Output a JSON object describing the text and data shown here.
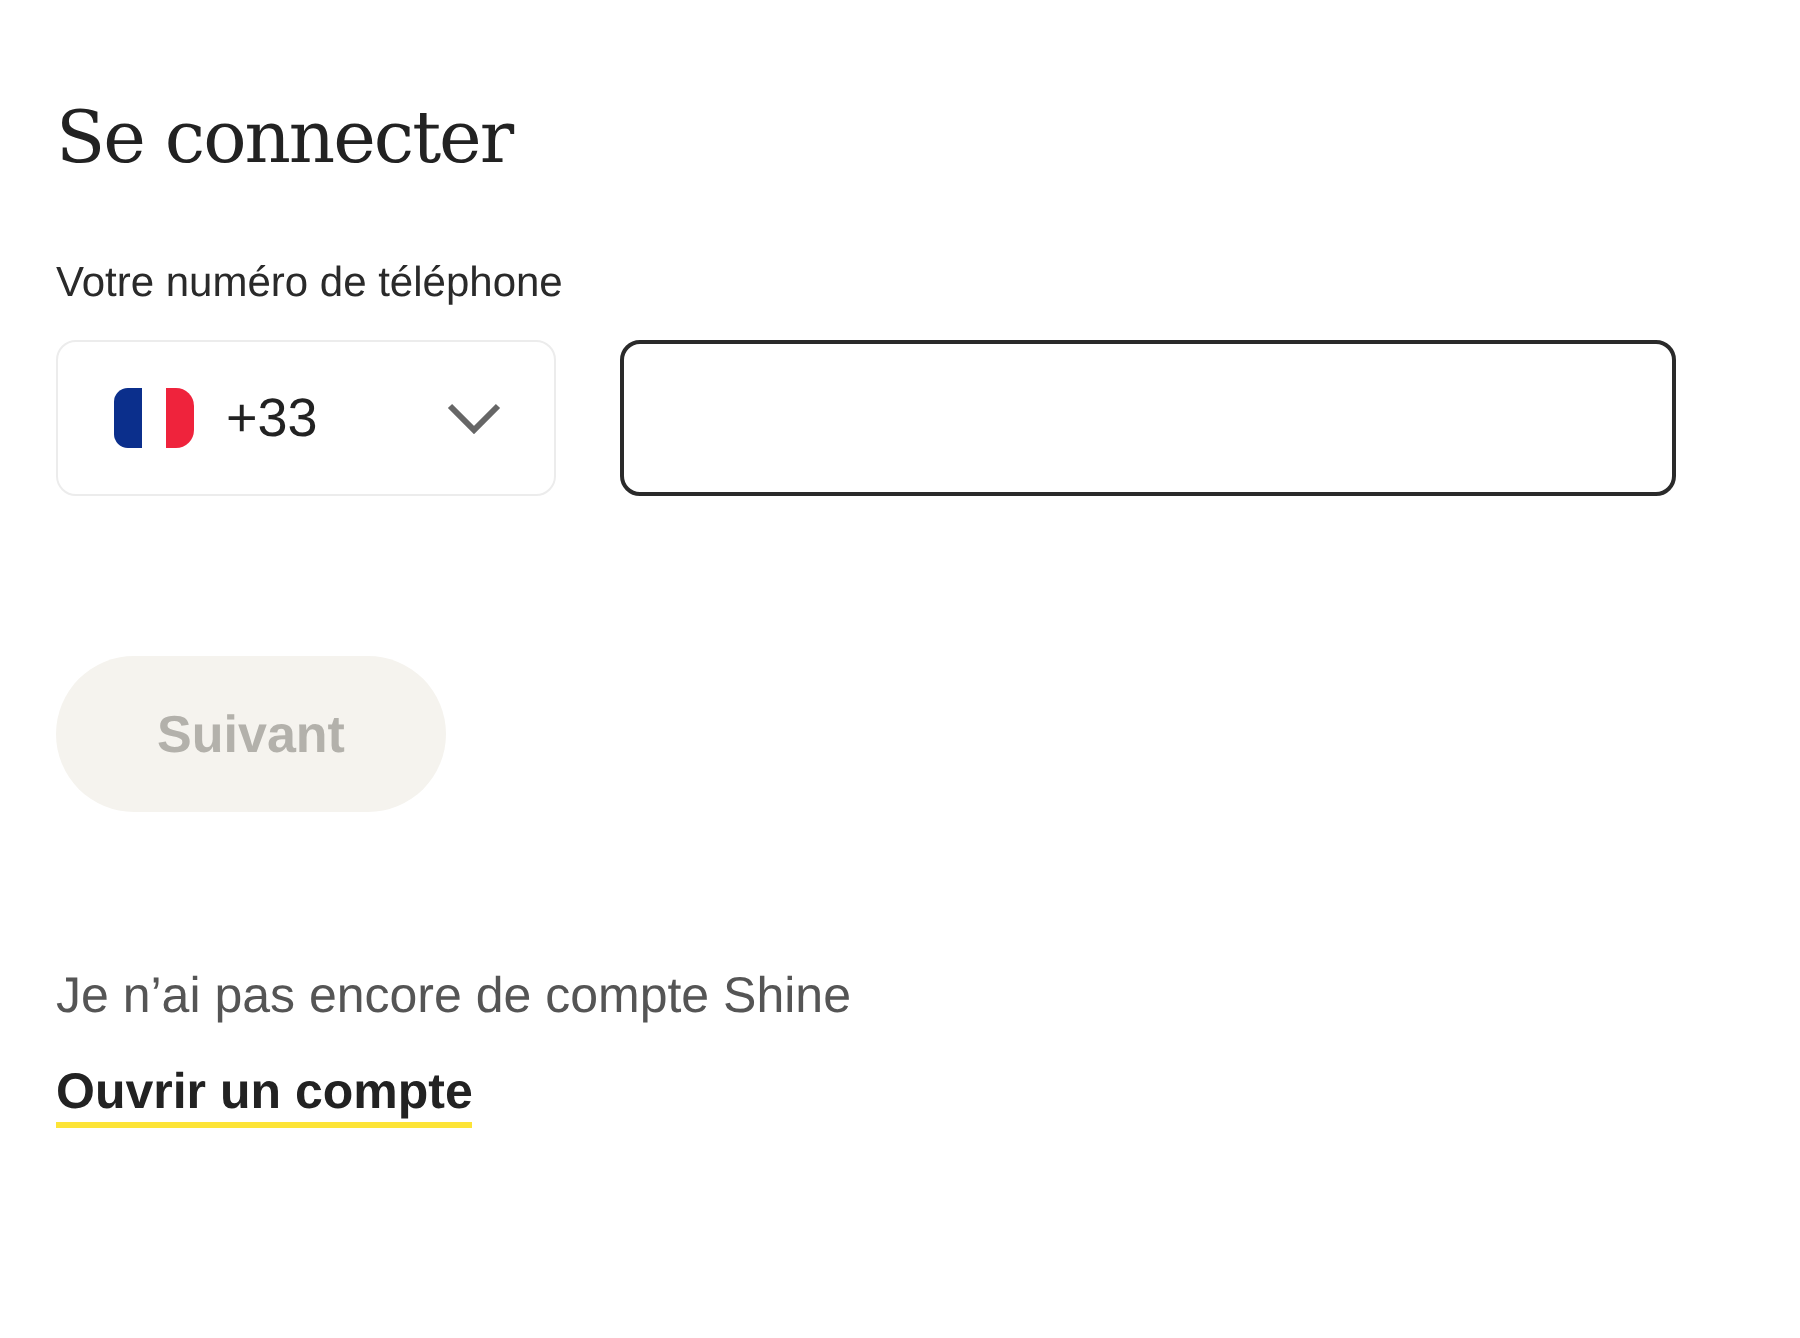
{
  "title": "Se connecter",
  "phone": {
    "label": "Votre numéro de téléphone",
    "country_code": "+33"
  },
  "next_button": {
    "label": "Suivant",
    "disabled": true
  },
  "signup": {
    "prompt": "Je n’ai pas encore de compte Shine",
    "link": "Ouvrir un compte"
  }
}
